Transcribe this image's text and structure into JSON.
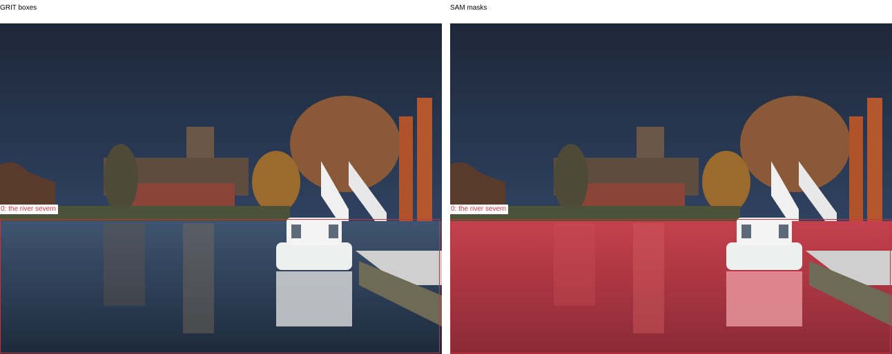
{
  "panels": [
    {
      "title": "GRIT boxes"
    },
    {
      "title": "SAM masks"
    }
  ],
  "detections": [
    {
      "label": "0: the river severn"
    }
  ],
  "colors": {
    "box": "#c8323c",
    "mask": "#e0303a",
    "sky_top": "#1f2b3e",
    "sky_bottom": "#3c5472",
    "water": "#34465f"
  }
}
